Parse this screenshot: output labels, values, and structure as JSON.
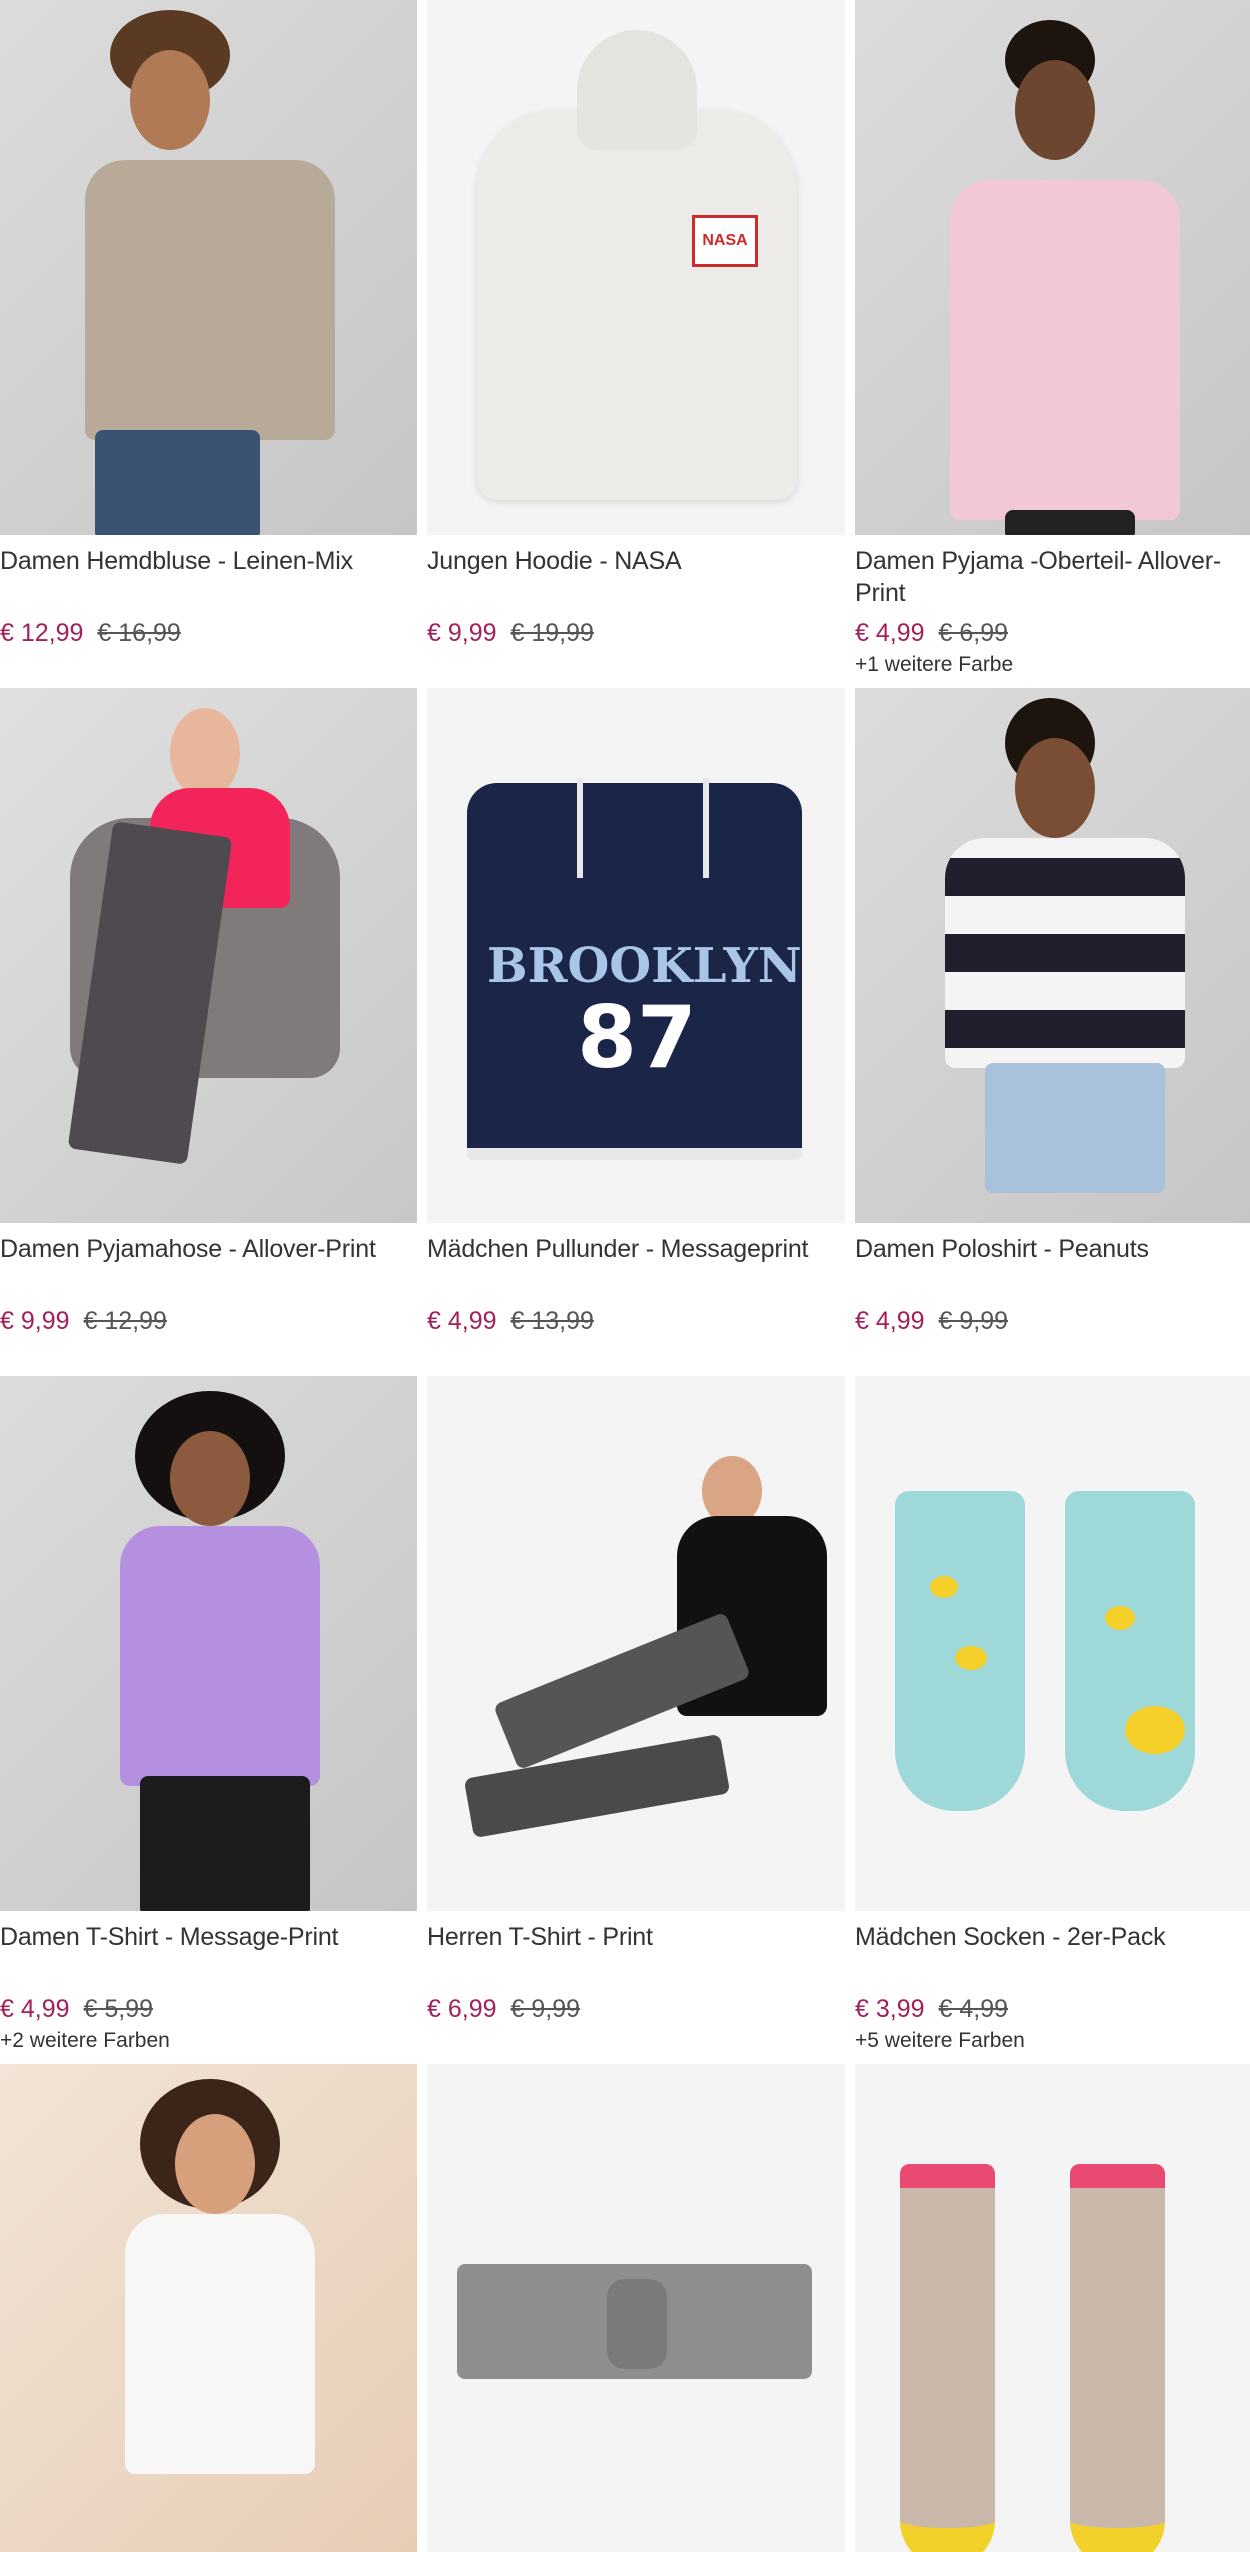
{
  "products": [
    {
      "name": "Damen Hemdbluse - Leinen-Mix",
      "price": "€ 12,99",
      "old_price": "€ 16,99",
      "more": "",
      "image": "woman-linen-blouse"
    },
    {
      "name": "Jungen Hoodie - NASA",
      "price": "€ 9,99",
      "old_price": "€ 19,99",
      "more": "",
      "image": "white-nasa-hoodie",
      "print": "NASA"
    },
    {
      "name": "Damen Pyjama -Oberteil- Allover-Print",
      "price": "€ 4,99",
      "old_price": "€ 6,99",
      "more": "+1 weitere Farbe",
      "image": "woman-pink-pyjama-top"
    },
    {
      "name": "Damen Pyjamahose - Allover-Print",
      "price": "€ 9,99",
      "old_price": "€ 12,99",
      "more": "",
      "image": "woman-armchair-pyjama-pants"
    },
    {
      "name": "Mädchen Pullunder - Messageprint",
      "price": "€ 4,99",
      "old_price": "€ 13,99",
      "more": "",
      "image": "navy-vest-brooklyn",
      "print_top": "BROOKLYN",
      "print_num": "87"
    },
    {
      "name": "Damen Poloshirt - Peanuts",
      "price": "€ 4,99",
      "old_price": "€ 9,99",
      "more": "",
      "image": "woman-striped-polo"
    },
    {
      "name": "Damen T-Shirt - Message-Print",
      "price": "€ 4,99",
      "old_price": "€ 5,99",
      "more": "+2 weitere Farben",
      "image": "woman-lilac-tshirt"
    },
    {
      "name": "Herren T-Shirt - Print",
      "price": "€ 6,99",
      "old_price": "€ 9,99",
      "more": "",
      "image": "man-black-tshirt"
    },
    {
      "name": "Mädchen Socken - 2er-Pack",
      "price": "€ 3,99",
      "old_price": "€ 4,99",
      "more": "+5 weitere Farben",
      "image": "duck-socks"
    },
    {
      "name": "",
      "price": "",
      "old_price": "",
      "more": "",
      "image": "woman-white-top"
    },
    {
      "name": "",
      "price": "",
      "old_price": "",
      "more": "",
      "image": "grey-headband"
    },
    {
      "name": "",
      "price": "",
      "old_price": "",
      "more": "",
      "image": "flamingo-socks"
    }
  ],
  "colors": {
    "sale_price": "#a3205a",
    "old_price": "#555555",
    "text": "#333333"
  }
}
